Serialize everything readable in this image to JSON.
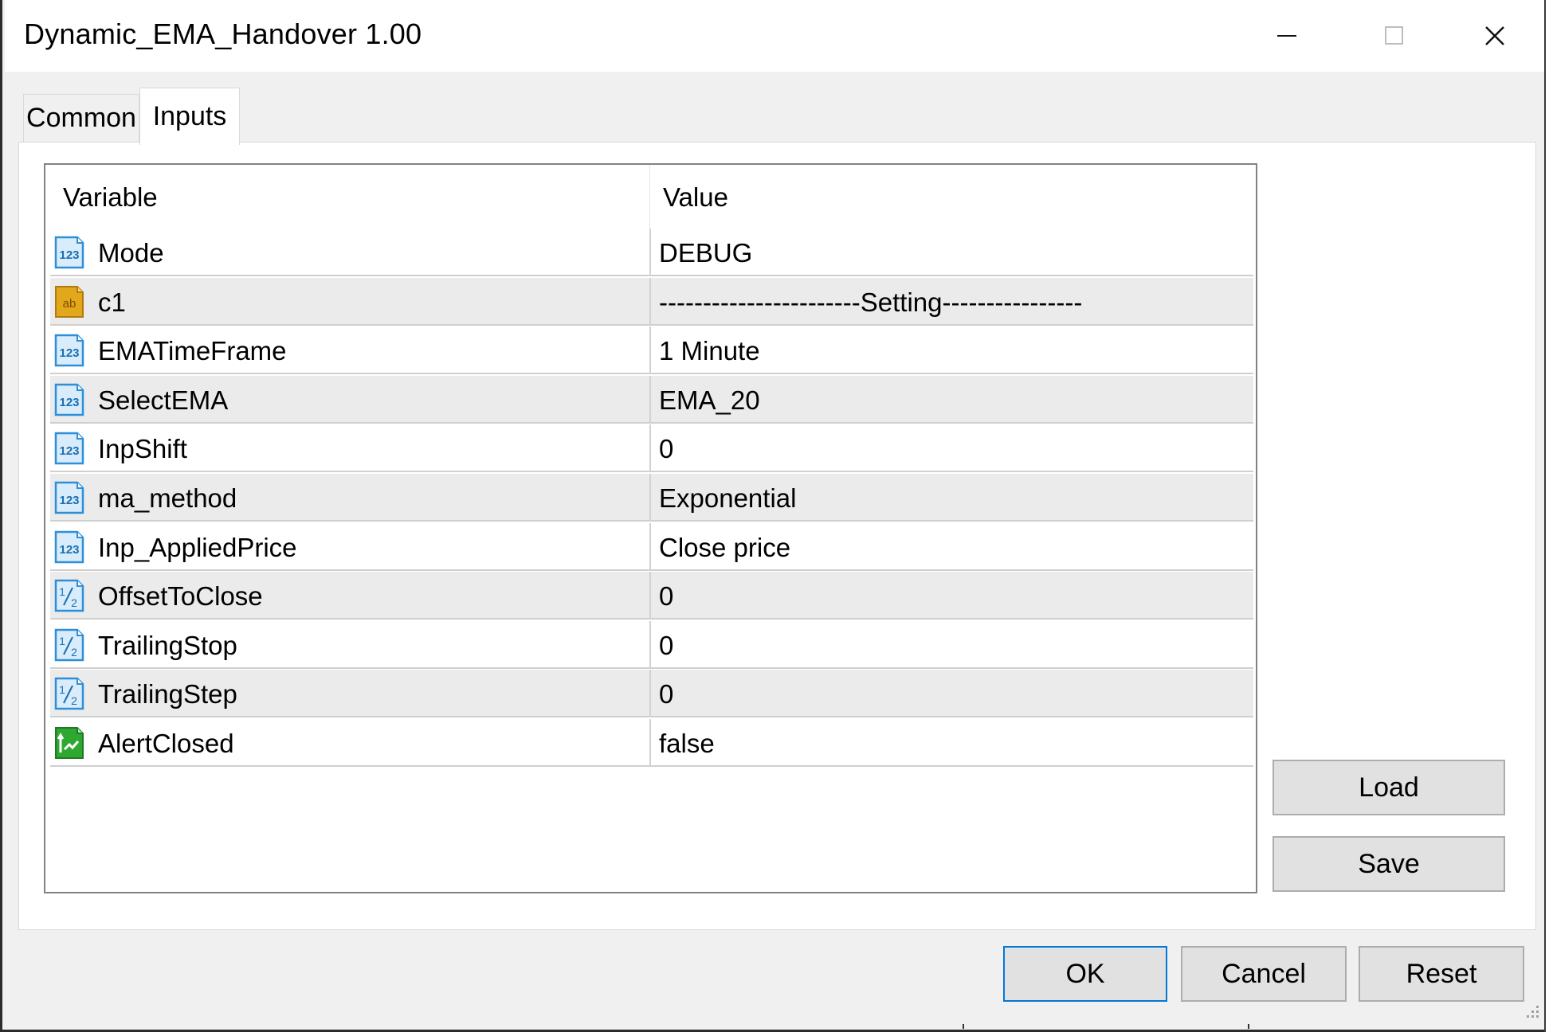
{
  "window": {
    "title": "Dynamic_EMA_Handover 1.00"
  },
  "tabs": [
    {
      "label": "Common"
    },
    {
      "label": "Inputs"
    }
  ],
  "grid": {
    "headers": {
      "variable": "Variable",
      "value": "Value"
    },
    "rows": [
      {
        "icon": "integer-icon",
        "variable": "Mode",
        "value": "DEBUG"
      },
      {
        "icon": "string-icon",
        "variable": "c1",
        "value": "-----------------------Setting----------------"
      },
      {
        "icon": "integer-icon",
        "variable": "EMATimeFrame",
        "value": "1 Minute"
      },
      {
        "icon": "integer-icon",
        "variable": "SelectEMA",
        "value": "EMA_20"
      },
      {
        "icon": "integer-icon",
        "variable": "InpShift",
        "value": "0"
      },
      {
        "icon": "integer-icon",
        "variable": "ma_method",
        "value": "Exponential"
      },
      {
        "icon": "integer-icon",
        "variable": "Inp_AppliedPrice",
        "value": "Close price"
      },
      {
        "icon": "fraction-icon",
        "variable": "OffsetToClose",
        "value": "0"
      },
      {
        "icon": "fraction-icon",
        "variable": "TrailingStop",
        "value": "0"
      },
      {
        "icon": "fraction-icon",
        "variable": "TrailingStep",
        "value": "0"
      },
      {
        "icon": "bool-icon",
        "variable": "AlertClosed",
        "value": "false"
      }
    ]
  },
  "side_buttons": {
    "load": "Load",
    "save": "Save"
  },
  "footer_buttons": {
    "ok": "OK",
    "cancel": "Cancel",
    "reset": "Reset"
  },
  "colors": {
    "integer_icon": "#2e8fd8",
    "string_icon": "#e2a71a",
    "bool_icon": "#2fa832",
    "ok_border": "#0078d7"
  }
}
